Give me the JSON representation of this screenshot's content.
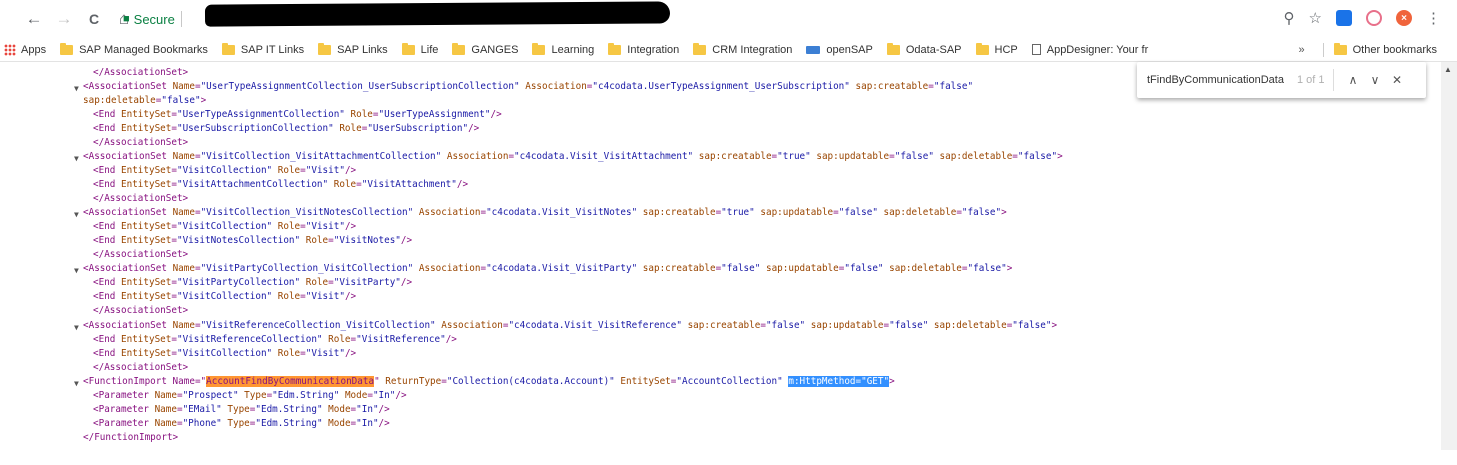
{
  "browser": {
    "nav": {
      "back_icon": "←",
      "forward_icon": "→",
      "reload_icon": "C",
      "home_icon": "⌂"
    },
    "address": {
      "secure_label": "Secure"
    },
    "toolbar_icons": {
      "key": "⚲",
      "star": "☆",
      "menu": "⋮"
    }
  },
  "bookmarks": {
    "items": [
      {
        "label": "Apps",
        "icon": "apps-grid-icon"
      },
      {
        "label": "SAP Managed Bookmarks",
        "icon": "folder-icon"
      },
      {
        "label": "SAP IT Links",
        "icon": "folder-icon"
      },
      {
        "label": "SAP Links",
        "icon": "folder-icon"
      },
      {
        "label": "Life",
        "icon": "folder-icon"
      },
      {
        "label": "GANGES",
        "icon": "folder-icon"
      },
      {
        "label": "Learning",
        "icon": "folder-icon"
      },
      {
        "label": "Integration",
        "icon": "folder-icon"
      },
      {
        "label": "CRM Integration",
        "icon": "folder-icon"
      },
      {
        "label": "openSAP",
        "icon": "opensap-icon"
      },
      {
        "label": "Odata-SAP",
        "icon": "folder-icon"
      },
      {
        "label": "HCP",
        "icon": "folder-icon"
      },
      {
        "label": "AppDesigner: Your fr",
        "icon": "page-icon"
      }
    ],
    "overflow": "»",
    "other": "Other bookmarks"
  },
  "findbar": {
    "query": "tFindByCommunicationData",
    "count": "1 of 1",
    "prev": "∧",
    "next": "∨",
    "close": "✕"
  },
  "xml": {
    "l01": "</AssociationSet>",
    "l02a": "<AssociationSet Name=\"UserTypeAssignmentCollection_UserSubscriptionCollection\" Association=\"c4codata.UserTypeAssignment_UserSubscription\" sap:creatable=\"false\"",
    "l02b": "sap:deletable=\"false\">",
    "l03": "<End EntitySet=\"UserTypeAssignmentCollection\" Role=\"UserTypeAssignment\"/>",
    "l04": "<End EntitySet=\"UserSubscriptionCollection\" Role=\"UserSubscription\"/>",
    "l05": "</AssociationSet>",
    "l06": "<AssociationSet Name=\"VisitCollection_VisitAttachmentCollection\" Association=\"c4codata.Visit_VisitAttachment\" sap:creatable=\"true\" sap:updatable=\"false\" sap:deletable=\"false\">",
    "l07": "<End EntitySet=\"VisitCollection\" Role=\"Visit\"/>",
    "l08": "<End EntitySet=\"VisitAttachmentCollection\" Role=\"VisitAttachment\"/>",
    "l09": "</AssociationSet>",
    "l10": "<AssociationSet Name=\"VisitCollection_VisitNotesCollection\" Association=\"c4codata.Visit_VisitNotes\" sap:creatable=\"true\" sap:updatable=\"false\" sap:deletable=\"false\">",
    "l11": "<End EntitySet=\"VisitCollection\" Role=\"Visit\"/>",
    "l12": "<End EntitySet=\"VisitNotesCollection\" Role=\"VisitNotes\"/>",
    "l13": "</AssociationSet>",
    "l14": "<AssociationSet Name=\"VisitPartyCollection_VisitCollection\" Association=\"c4codata.Visit_VisitParty\" sap:creatable=\"false\" sap:updatable=\"false\" sap:deletable=\"false\">",
    "l15": "<End EntitySet=\"VisitPartyCollection\" Role=\"VisitParty\"/>",
    "l16": "<End EntitySet=\"VisitCollection\" Role=\"Visit\"/>",
    "l17": "</AssociationSet>",
    "l18": "<AssociationSet Name=\"VisitReferenceCollection_VisitCollection\" Association=\"c4codata.Visit_VisitReference\" sap:creatable=\"false\" sap:updatable=\"false\" sap:deletable=\"false\">",
    "l19": "<End EntitySet=\"VisitReferenceCollection\" Role=\"VisitReference\"/>",
    "l20": "<End EntitySet=\"VisitCollection\" Role=\"Visit\"/>",
    "l21": "</AssociationSet>",
    "l22_pre": "<FunctionImport Name=\"",
    "l22_match": "AccountFindByCommunicationData",
    "l22_mid": "\" ReturnType=\"Collection(c4codata.Account)\" EntitySet=\"AccountCollection\" ",
    "l22_sel": "m:HttpMethod=\"GET\"",
    "l22_end": ">",
    "l23": "<Parameter Name=\"Prospect\" Type=\"Edm.String\" Mode=\"In\"/>",
    "l24": "<Parameter Name=\"EMail\" Type=\"Edm.String\" Mode=\"In\"/>",
    "l25": "<Parameter Name=\"Phone\" Type=\"Edm.String\" Mode=\"In\"/>",
    "l26": "</FunctionImport>",
    "toggle": "▼"
  },
  "colors": {
    "tag": "#881280",
    "attr_name": "#994500",
    "attr_value": "#1a1aa6",
    "find_highlight": "#ff9632",
    "selection": "#3390ff",
    "secure_green": "#0b8043"
  }
}
